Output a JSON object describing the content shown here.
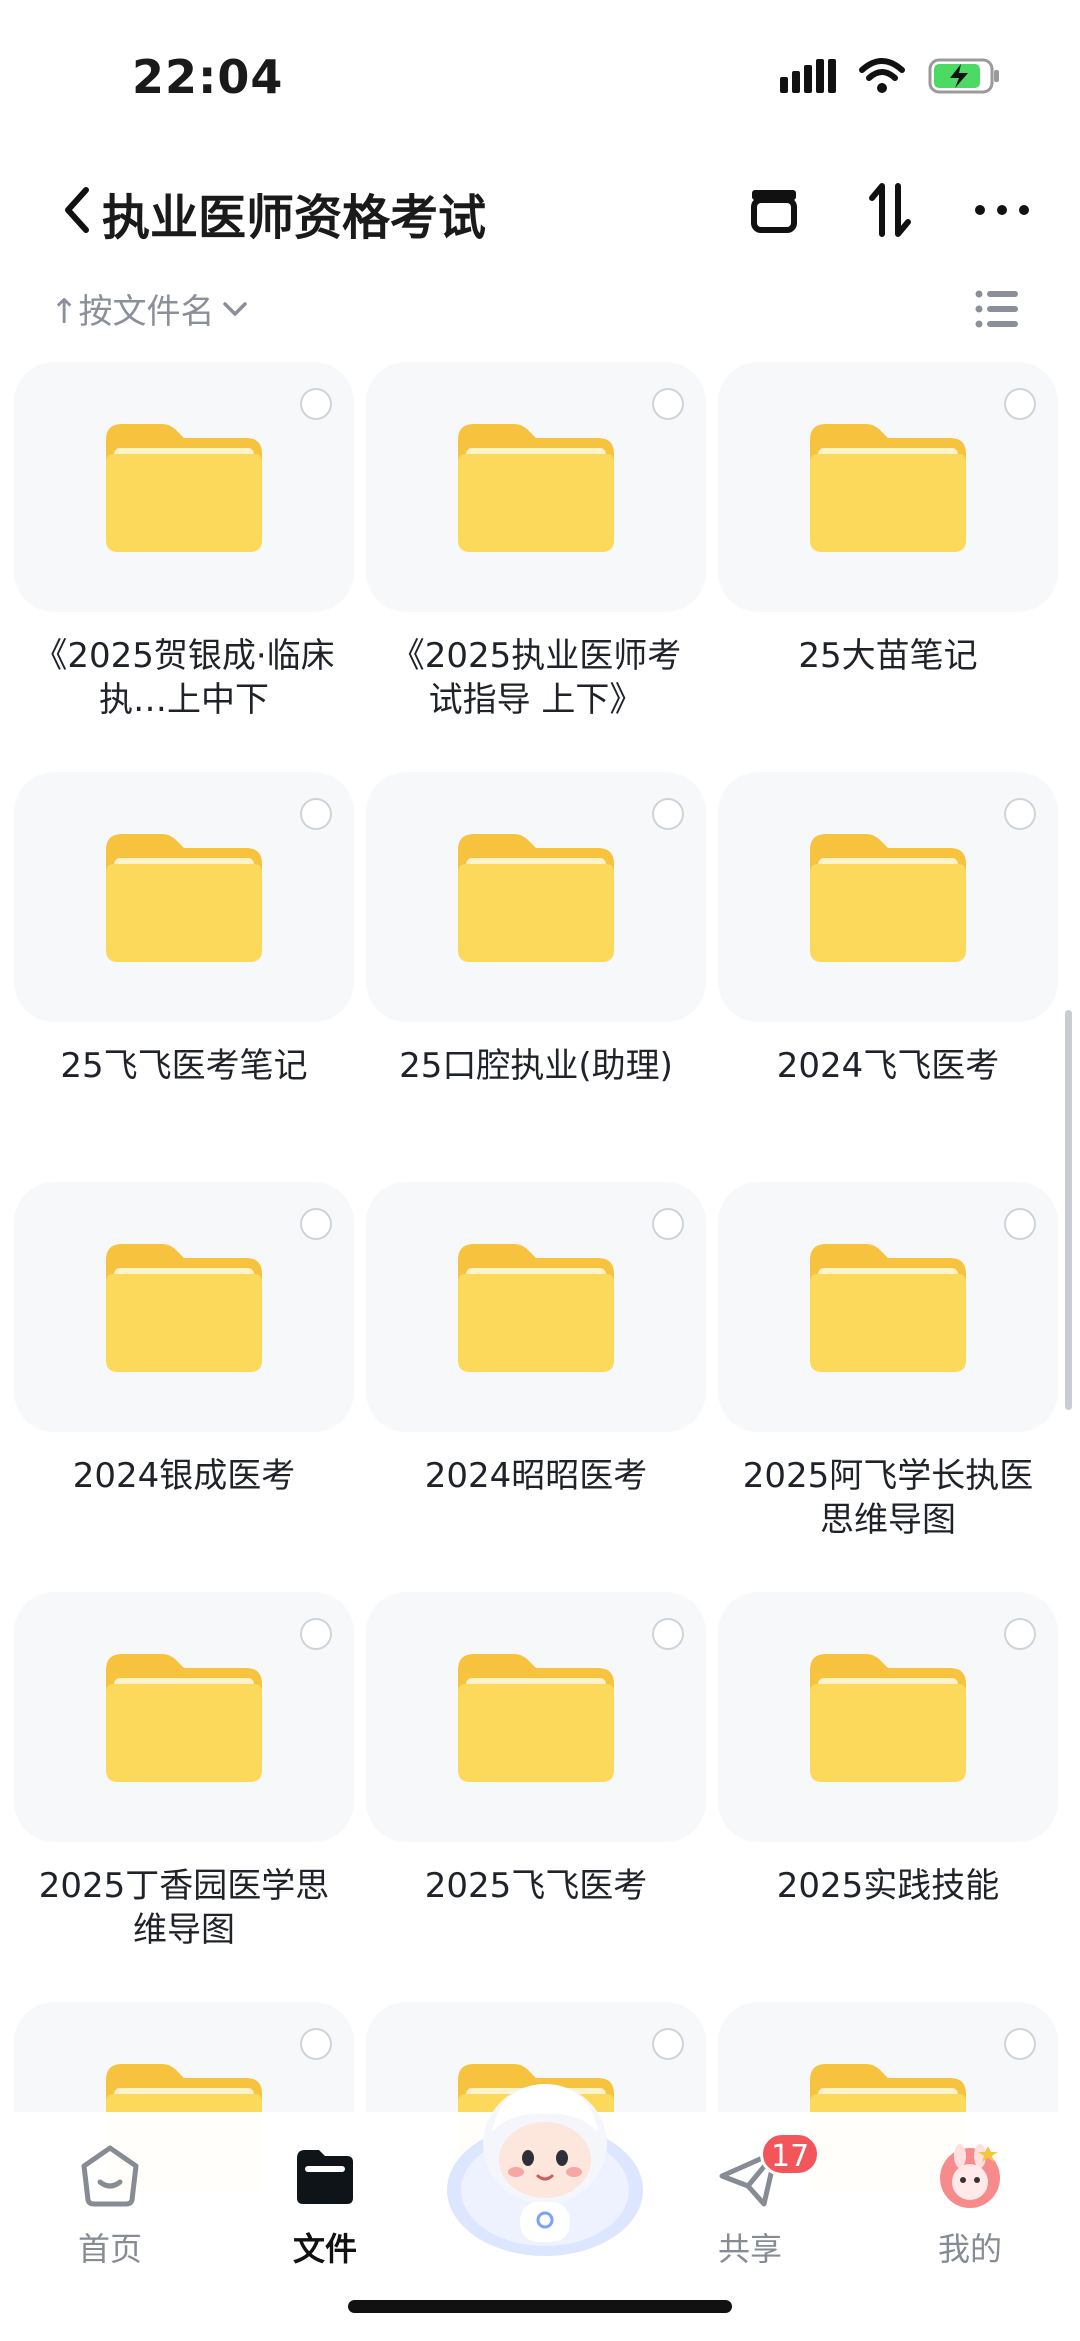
{
  "status_bar": {
    "time": "22:04",
    "icons": [
      "signal-icon",
      "wifi-icon",
      "battery-charging-icon"
    ]
  },
  "nav": {
    "back_icon": "chevron-left-icon",
    "title": "执业医师资格考试",
    "actions": [
      "archive-icon",
      "sort-transfer-icon",
      "more-icon"
    ]
  },
  "sort": {
    "label": "↑按文件名",
    "dropdown_icon": "chevron-down-icon",
    "view_icon": "list-view-icon"
  },
  "folders": [
    {
      "name": "《2025贺银成·临床执…上中下"
    },
    {
      "name": "《2025执业医师考试指导 上下》"
    },
    {
      "name": "25大苗笔记"
    },
    {
      "name": "25飞飞医考笔记"
    },
    {
      "name": "25口腔执业(助理)"
    },
    {
      "name": "2024飞飞医考"
    },
    {
      "name": "2024银成医考"
    },
    {
      "name": "2024昭昭医考"
    },
    {
      "name": "2025阿飞学长执医思维导图"
    },
    {
      "name": "2025丁香园医学思维导图"
    },
    {
      "name": "2025飞飞医考"
    },
    {
      "name": "2025实践技能"
    },
    {
      "name": ""
    },
    {
      "name": ""
    },
    {
      "name": ""
    }
  ],
  "tabs": [
    {
      "label": "首页",
      "icon": "home-icon",
      "active": false
    },
    {
      "label": "文件",
      "icon": "folder-icon",
      "active": true
    },
    {
      "label": "",
      "icon": "mascot-icon",
      "active": false
    },
    {
      "label": "共享",
      "icon": "send-icon",
      "active": false,
      "badge": "17"
    },
    {
      "label": "我的",
      "icon": "avatar-icon",
      "active": false
    }
  ],
  "colors": {
    "folder_back": "#f7c23d",
    "folder_front": "#fcd95a",
    "tile_bg": "#f7f8fa",
    "badge": "#f2555a",
    "battery": "#4cd964"
  }
}
